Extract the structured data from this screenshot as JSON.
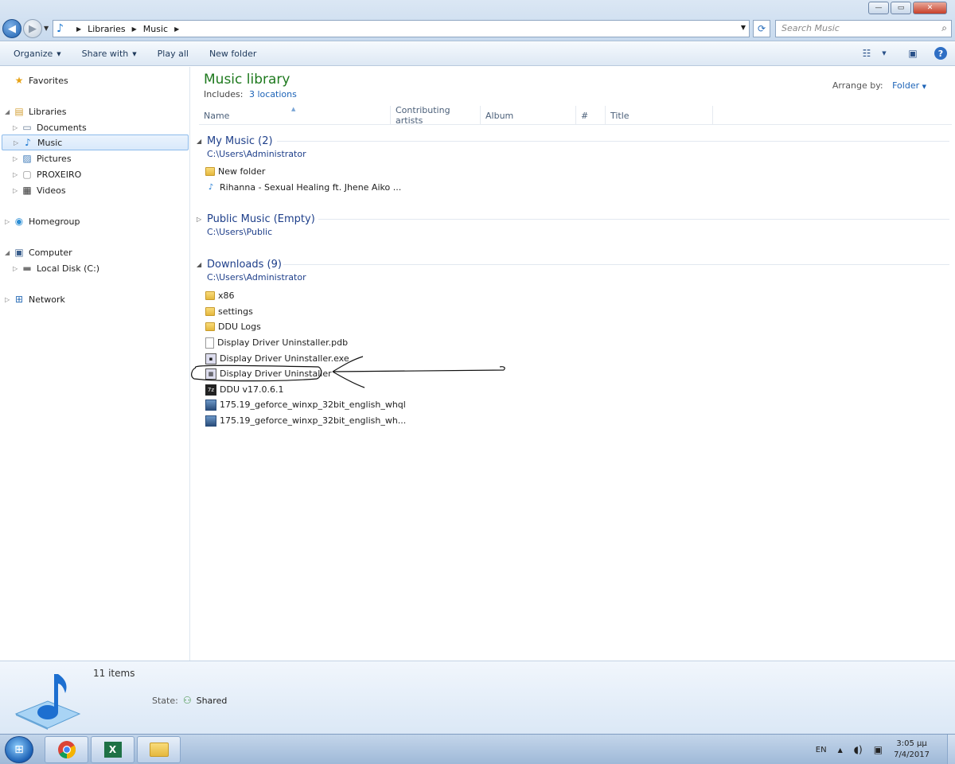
{
  "titlebar": {
    "minimize_label": "—",
    "restore_label": "▭",
    "close_label": "✕"
  },
  "address": {
    "crumbs": [
      "Libraries",
      "Music"
    ]
  },
  "search": {
    "placeholder": "Search Music"
  },
  "toolbar": {
    "organize": "Organize",
    "share_with": "Share with",
    "play_all": "Play all",
    "new_folder": "New folder"
  },
  "navpane": {
    "favorites": "Favorites",
    "libraries": "Libraries",
    "documents": "Documents",
    "music": "Music",
    "pictures": "Pictures",
    "proxeiro": "PROXEIRO",
    "videos": "Videos",
    "homegroup": "Homegroup",
    "computer": "Computer",
    "local_disk": "Local Disk (C:)",
    "network": "Network"
  },
  "library": {
    "title": "Music library",
    "includes_label": "Includes:",
    "includes_link": "3 locations",
    "arrange_label": "Arrange by:",
    "arrange_value": "Folder"
  },
  "columns": [
    "Name",
    "Contributing artists",
    "Album",
    "#",
    "Title"
  ],
  "groups": {
    "my_music": {
      "title": "My Music (2)",
      "path": "C:\\Users\\Administrator",
      "items": [
        "New folder",
        "Rihanna - Sexual Healing ft. Jhene Aiko ..."
      ]
    },
    "public_music": {
      "title": "Public Music (Empty)",
      "path": "C:\\Users\\Public"
    },
    "downloads": {
      "title": "Downloads (9)",
      "path": "C:\\Users\\Administrator",
      "items": [
        "x86",
        "settings",
        "DDU Logs",
        "Display Driver Uninstaller.pdb",
        "Display Driver Uninstaller.exe",
        "Display Driver Uninstaller",
        "DDU v17.0.6.1",
        "175.19_geforce_winxp_32bit_english_whql",
        "175.19_geforce_winxp_32bit_english_wh..."
      ]
    }
  },
  "details": {
    "count": "11 items",
    "state_label": "State:",
    "state_value": "Shared"
  },
  "tray": {
    "lang": "EN",
    "time": "3:05 μμ",
    "date": "7/4/2017"
  },
  "colors": {
    "library_title": "#1f7a1f",
    "group_title": "#1e3f8a",
    "link": "#1c63b7"
  }
}
